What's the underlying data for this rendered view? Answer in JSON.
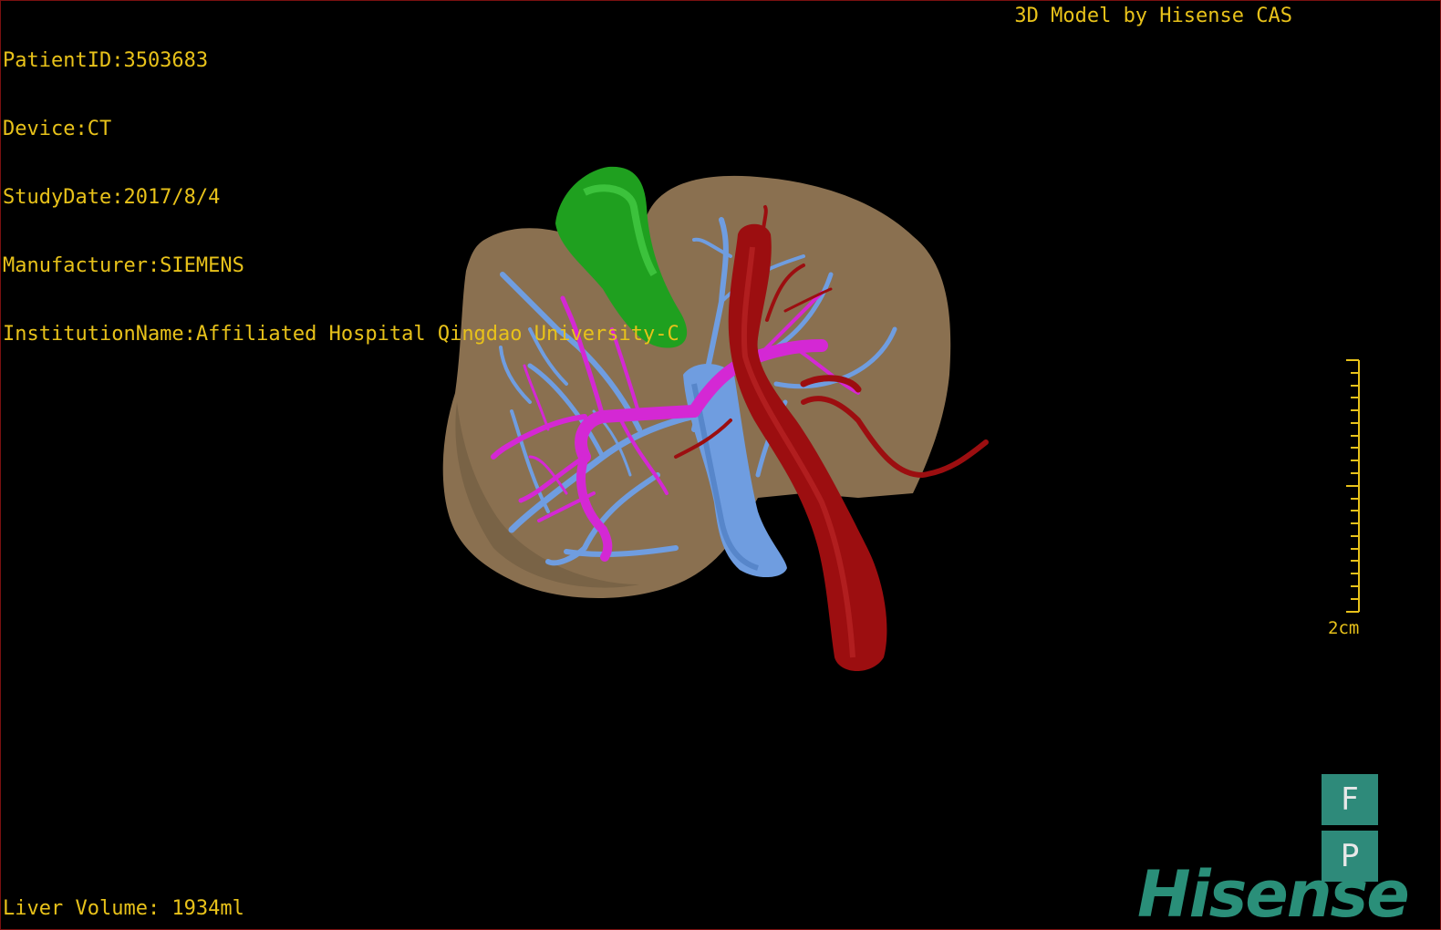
{
  "overlay": {
    "info_lines": [
      "PatientID:3503683",
      "Device:CT",
      "StudyDate:2017/8/4",
      "Manufacturer:SIEMENS",
      "InstitutionName:Affiliated Hospital Qingdao University-C"
    ],
    "credit": "3D Model by Hisense CAS",
    "liver_volume": "Liver Volume: 1934ml"
  },
  "scale_bar": {
    "label": "2cm"
  },
  "orientation_cube": {
    "front": "F",
    "posterior": "P"
  },
  "logo": {
    "text": "Hisense"
  },
  "colors": {
    "overlay_text": "#e8c21a",
    "liver": "#8a7050",
    "gallbladder": "#1fa01f",
    "aorta": "#9c0e10",
    "portal_vein": "#d428d4",
    "hepatic_vein": "#6f9de0",
    "brand": "#2a8f79"
  },
  "model": {
    "structures": [
      "liver-model",
      "gallbladder-model",
      "aorta-model",
      "portal-vein-tree",
      "hepatic-vein-tree",
      "inferior-vena-cava"
    ]
  }
}
